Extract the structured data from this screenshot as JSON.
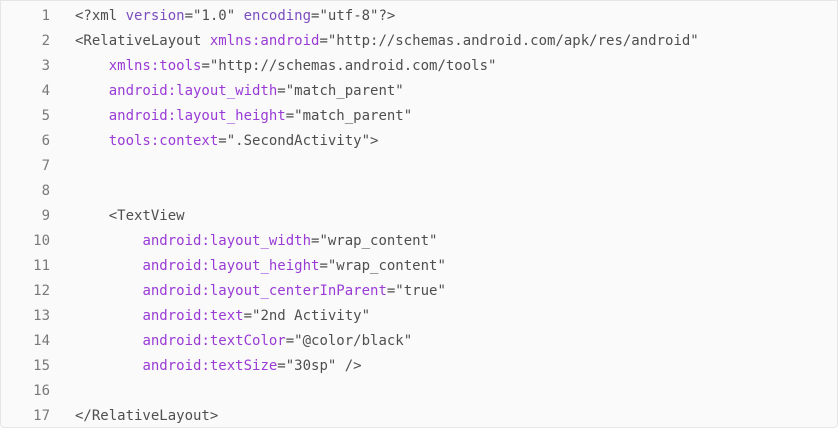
{
  "code_view": {
    "lines": [
      {
        "num": "1",
        "tokens": [
          {
            "t": "<?xml ",
            "c": "tag"
          },
          {
            "t": "version",
            "c": "kw"
          },
          {
            "t": "=\"1.0\" ",
            "c": "str"
          },
          {
            "t": "encoding",
            "c": "kw"
          },
          {
            "t": "=\"utf-8\"?>",
            "c": "str"
          }
        ]
      },
      {
        "num": "2",
        "tokens": [
          {
            "t": "<RelativeLayout ",
            "c": "tag"
          },
          {
            "t": "xmlns:android",
            "c": "attr"
          },
          {
            "t": "=\"http://schemas.android.com/apk/res/android\"",
            "c": "str"
          }
        ]
      },
      {
        "num": "3",
        "tokens": [
          {
            "t": "    ",
            "c": "str"
          },
          {
            "t": "xmlns:tools",
            "c": "attr"
          },
          {
            "t": "=\"http://schemas.android.com/tools\"",
            "c": "str"
          }
        ]
      },
      {
        "num": "4",
        "tokens": [
          {
            "t": "    ",
            "c": "str"
          },
          {
            "t": "android:layout_width",
            "c": "attr"
          },
          {
            "t": "=\"match_parent\"",
            "c": "str"
          }
        ]
      },
      {
        "num": "5",
        "tokens": [
          {
            "t": "    ",
            "c": "str"
          },
          {
            "t": "android:layout_height",
            "c": "attr"
          },
          {
            "t": "=\"match_parent\"",
            "c": "str"
          }
        ]
      },
      {
        "num": "6",
        "tokens": [
          {
            "t": "    ",
            "c": "str"
          },
          {
            "t": "tools:context",
            "c": "attr"
          },
          {
            "t": "=\".SecondActivity\">",
            "c": "str"
          }
        ]
      },
      {
        "num": "7",
        "tokens": []
      },
      {
        "num": "8",
        "tokens": []
      },
      {
        "num": "9",
        "tokens": [
          {
            "t": "    <TextView",
            "c": "tag"
          }
        ]
      },
      {
        "num": "10",
        "tokens": [
          {
            "t": "        ",
            "c": "str"
          },
          {
            "t": "android:layout_width",
            "c": "attr"
          },
          {
            "t": "=\"wrap_content\"",
            "c": "str"
          }
        ]
      },
      {
        "num": "11",
        "tokens": [
          {
            "t": "        ",
            "c": "str"
          },
          {
            "t": "android:layout_height",
            "c": "attr"
          },
          {
            "t": "=\"wrap_content\"",
            "c": "str"
          }
        ]
      },
      {
        "num": "12",
        "tokens": [
          {
            "t": "        ",
            "c": "str"
          },
          {
            "t": "android:layout_centerInParent",
            "c": "attr"
          },
          {
            "t": "=\"true\"",
            "c": "str"
          }
        ]
      },
      {
        "num": "13",
        "tokens": [
          {
            "t": "        ",
            "c": "str"
          },
          {
            "t": "android:text",
            "c": "attr"
          },
          {
            "t": "=\"2nd Activity\"",
            "c": "str"
          }
        ]
      },
      {
        "num": "14",
        "tokens": [
          {
            "t": "        ",
            "c": "str"
          },
          {
            "t": "android:textColor",
            "c": "attr"
          },
          {
            "t": "=\"@color/black\"",
            "c": "str"
          }
        ]
      },
      {
        "num": "15",
        "tokens": [
          {
            "t": "        ",
            "c": "str"
          },
          {
            "t": "android:textSize",
            "c": "attr"
          },
          {
            "t": "=\"30sp\" />",
            "c": "str"
          }
        ]
      },
      {
        "num": "16",
        "tokens": []
      },
      {
        "num": "17",
        "tokens": [
          {
            "t": "</RelativeLayout>",
            "c": "tag"
          }
        ]
      }
    ]
  },
  "colors": {
    "background": "#fafafa",
    "line_number": "#7a7a7a",
    "tag": "#4f4f4f",
    "attribute": "#9a3bd6",
    "keyword": "#7c4dbf"
  }
}
